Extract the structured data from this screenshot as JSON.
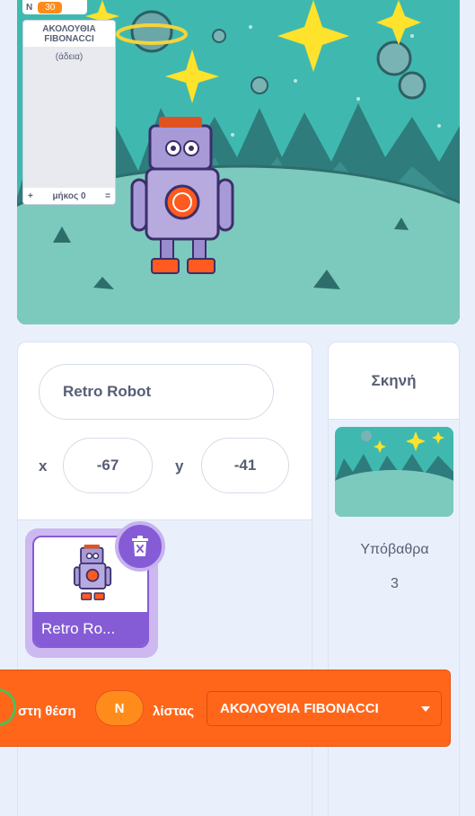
{
  "monitor": {
    "var_name": "N",
    "var_value": "30"
  },
  "list_monitor": {
    "title": "ΑΚΟΛΟΥΘΙΑ FIBONACCI",
    "empty_text": "(άδεια)",
    "add_symbol": "+",
    "length_text": "μήκος 0",
    "resize_symbol": "="
  },
  "sprite_info": {
    "name": "Retro Robot",
    "x_label": "x",
    "x_value": "-67",
    "y_label": "y",
    "y_value": "-41"
  },
  "sprite_tile": {
    "label": "Retro Ro..."
  },
  "stage_panel": {
    "title": "Σκηνή",
    "backdrops_label": "Υπόβαθρα",
    "backdrops_count": "3"
  },
  "block": {
    "text_before": "στη θέση",
    "input_value": "N",
    "text_middle": "λίστας",
    "dropdown_value": "ΑΚΟΛΟΥΘΙΑ FIBONACCI"
  },
  "colors": {
    "accent": "#855cd6",
    "list_block": "#ff661a",
    "variable": "#ff8c1a",
    "stage_sky": "#3fb9b0"
  },
  "icons": [
    "trash-icon",
    "dropdown-caret-icon"
  ]
}
